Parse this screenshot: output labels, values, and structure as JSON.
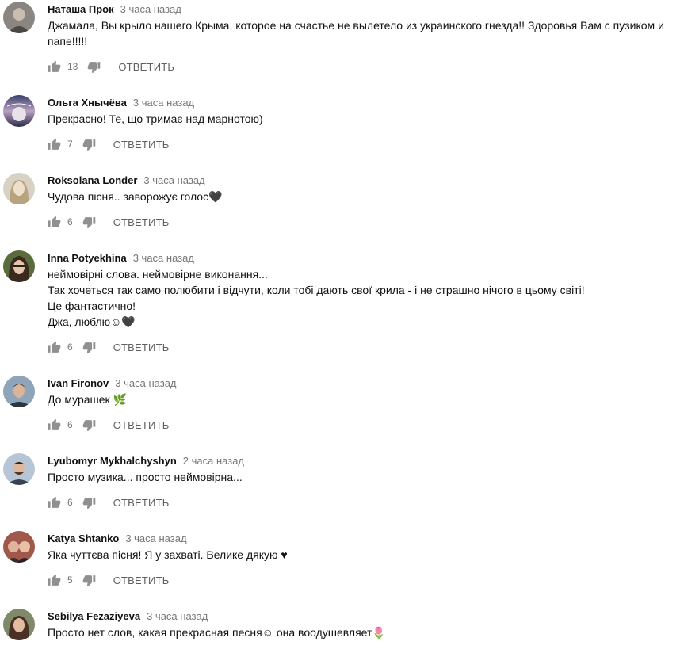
{
  "comments": [
    {
      "author": "Наташа Прок",
      "time": "3 часа назад",
      "lines": [
        "Джамала, Вы крыло нашего Крыма, которое на счастье не вылетело из украинского гнезда!! Здоровья Вам с пузиком и",
        "папе!!!!!"
      ],
      "likes": "13",
      "reply": "ОТВЕТИТЬ",
      "avatar_icon": "avatar-photo"
    },
    {
      "author": "Ольга Хнычёва",
      "time": "3 часа назад",
      "lines": [
        "Прекрасно! Те, що тримає над марнотою)"
      ],
      "likes": "7",
      "reply": "ОТВЕТИТЬ",
      "avatar_icon": "avatar-photo"
    },
    {
      "author": "Roksolana Londer",
      "time": "3 часа назад",
      "lines": [
        "Чудова пісня.. заворожує голос🖤"
      ],
      "likes": "6",
      "reply": "ОТВЕТИТЬ",
      "avatar_icon": "avatar-photo"
    },
    {
      "author": "Inna Potyekhina",
      "time": "3 часа назад",
      "lines": [
        "неймовірні слова. неймовірне виконання...",
        "Так хочеться так само полюбити і відчути, коли тобі дають свої крила - і не страшно нічого в цьому світі!",
        "Це фантастично!",
        "Джа, люблю☺🖤"
      ],
      "likes": "6",
      "reply": "ОТВЕТИТЬ",
      "avatar_icon": "avatar-photo"
    },
    {
      "author": "Ivan Fironov",
      "time": "3 часа назад",
      "lines": [
        "До мурашек 🌿"
      ],
      "likes": "6",
      "reply": "ОТВЕТИТЬ",
      "avatar_icon": "avatar-photo"
    },
    {
      "author": "Lyubomyr Mykhalchyshyn",
      "time": "2 часа назад",
      "lines": [
        "Просто музика... просто неймовірна..."
      ],
      "likes": "6",
      "reply": "ОТВЕТИТЬ",
      "avatar_icon": "avatar-photo"
    },
    {
      "author": "Katya Shtanko",
      "time": "3 часа назад",
      "lines": [
        "Яка чуттєва пісня! Я у захваті. Велике дякую ♥"
      ],
      "likes": "5",
      "reply": "ОТВЕТИТЬ",
      "avatar_icon": "avatar-photo"
    },
    {
      "author": "Sebilya Fezaziyeva",
      "time": "3 часа назад",
      "lines": [
        "Просто нет слов, какая прекрасная песня☺ она воодушевляет🌷"
      ],
      "likes": "",
      "reply": "",
      "avatar_icon": "avatar-photo"
    }
  ],
  "colors": {
    "author": "#111111",
    "timestamp": "#767676",
    "text": "#111111",
    "icon": "#909090",
    "reply": "#606060"
  }
}
